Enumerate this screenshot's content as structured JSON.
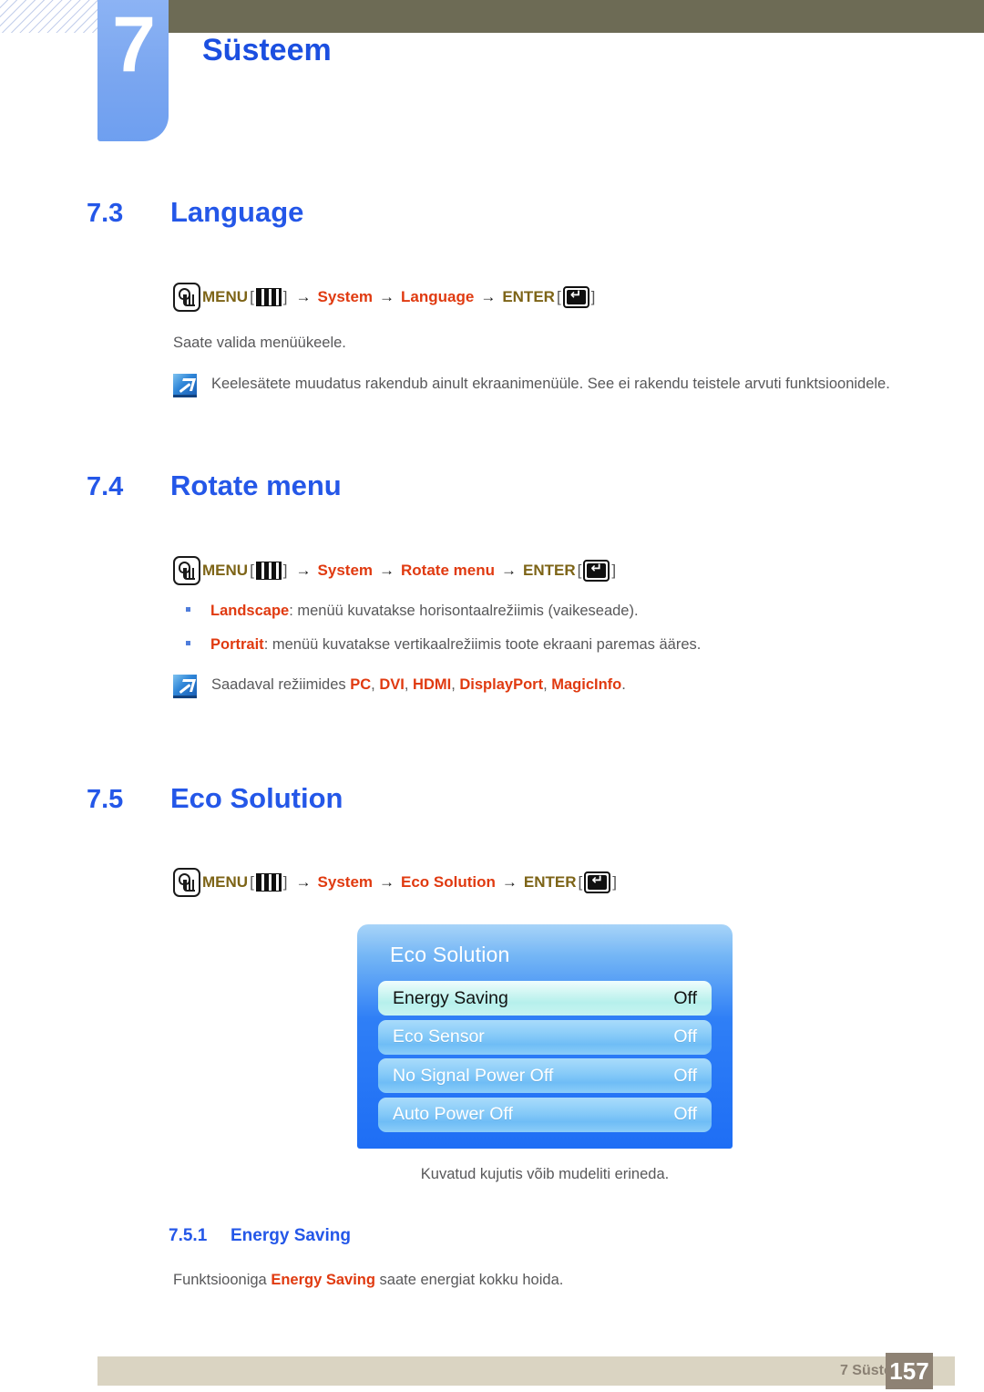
{
  "header": {
    "chapter_number": "7",
    "chapter_title": "Süsteem"
  },
  "sections": [
    {
      "number": "7.3",
      "title": "Language",
      "menu_path": {
        "menu_label": "MENU",
        "bars_bracket_open": "[",
        "bars_bracket_close": "]",
        "arrow": "→",
        "node1": "System",
        "node2": "Language",
        "enter_label": "ENTER",
        "enter_bracket_open": "[",
        "enter_bracket_close": "]"
      },
      "paragraph": "Saate valida menüükeele.",
      "note": "Keelesätete muudatus rakendub ainult ekraanimenüüle. See ei rakendu teistele arvuti funktsioonidele."
    },
    {
      "number": "7.4",
      "title": "Rotate menu",
      "menu_path": {
        "menu_label": "MENU",
        "bars_bracket_open": "[",
        "bars_bracket_close": "]",
        "arrow": "→",
        "node1": "System",
        "node2": "Rotate menu",
        "enter_label": "ENTER",
        "enter_bracket_open": "[",
        "enter_bracket_close": "]"
      },
      "bullets": [
        {
          "term": "Landscape",
          "rest": ": menüü kuvatakse horisontaalrežiimis (vaikeseade)."
        },
        {
          "term": "Portrait",
          "rest": ": menüü kuvatakse vertikaalrežiimis toote ekraani paremas ääres."
        }
      ],
      "note_prefix": "Saadaval režiimides ",
      "note_modes": [
        "PC",
        "DVI",
        "HDMI",
        "DisplayPort",
        "MagicInfo"
      ],
      "note_suffix": "."
    },
    {
      "number": "7.5",
      "title": "Eco Solution",
      "menu_path": {
        "menu_label": "MENU",
        "bars_bracket_open": "[",
        "bars_bracket_close": "]",
        "arrow": "→",
        "node1": "System",
        "node2": "Eco Solution",
        "enter_label": "ENTER",
        "enter_bracket_open": "[",
        "enter_bracket_close": "]"
      }
    }
  ],
  "osd": {
    "title": "Eco Solution",
    "rows": [
      {
        "label": "Energy Saving",
        "value": "Off",
        "selected": true
      },
      {
        "label": "Eco Sensor",
        "value": "Off",
        "selected": false
      },
      {
        "label": "No Signal Power Off",
        "value": "Off",
        "selected": false
      },
      {
        "label": "Auto Power Off",
        "value": "Off",
        "selected": false
      }
    ],
    "caption": "Kuvatud kujutis võib mudeliti erineda."
  },
  "subsection": {
    "number": "7.5.1",
    "title": "Energy Saving",
    "text_prefix": "Funktsiooniga ",
    "text_highlight": "Energy Saving",
    "text_suffix": " saate energiat kokku hoida."
  },
  "footer": {
    "label": "7 Süsteem",
    "page": "157"
  },
  "colors": {
    "heading_blue": "#2457e8",
    "menu_olive": "#7d6417",
    "node_orange": "#e03a10",
    "body_gray": "#58585a",
    "topbar_olive": "#6d6b55",
    "tab_blue": "#7aa6f0",
    "footer_beige": "#dad4c2",
    "footer_page_brown": "#8e8274",
    "osd_blue": "#1e6ef5",
    "osd_selected": "#b6f0ec"
  }
}
